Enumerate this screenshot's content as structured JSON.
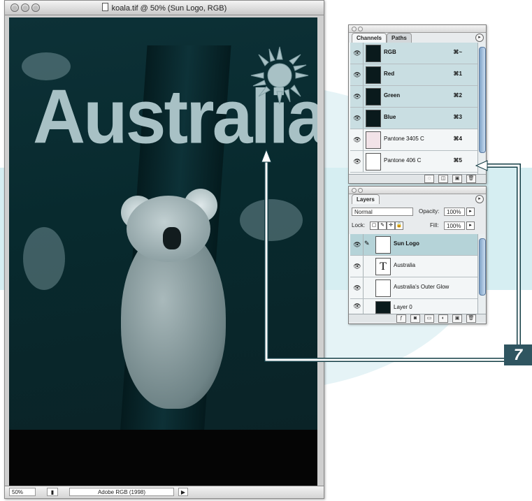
{
  "document": {
    "title": "koala.tif @ 50% (Sun Logo, RGB)",
    "artwork_text": "Australia",
    "status_zoom": "50%",
    "status_profile": "Adobe RGB (1998)"
  },
  "channels_palette": {
    "tabs": [
      "Channels",
      "Paths"
    ],
    "rows": [
      {
        "label": "RGB",
        "shortcut": "⌘~"
      },
      {
        "label": "Red",
        "shortcut": "⌘1"
      },
      {
        "label": "Green",
        "shortcut": "⌘2"
      },
      {
        "label": "Blue",
        "shortcut": "⌘3"
      },
      {
        "label": "Pantone 3405 C",
        "shortcut": "⌘4"
      },
      {
        "label": "Pantone 406 C",
        "shortcut": "⌘5"
      }
    ]
  },
  "layers_palette": {
    "tab": "Layers",
    "blend_mode": "Normal",
    "opacity_label": "Opacity:",
    "opacity_value": "100%",
    "lock_label": "Lock:",
    "fill_label": "Fill:",
    "fill_value": "100%",
    "layers": [
      {
        "label": "Sun Logo"
      },
      {
        "label": "Australia",
        "type_glyph": "T"
      },
      {
        "label": "Australia's Outer Glow"
      },
      {
        "label": "Layer 0"
      }
    ]
  },
  "callout": {
    "step": "7"
  },
  "colors": {
    "callout_bar": "#2f5560",
    "selected_row": "#b5d3d8",
    "canvas_teal": "#0a2a2e"
  }
}
